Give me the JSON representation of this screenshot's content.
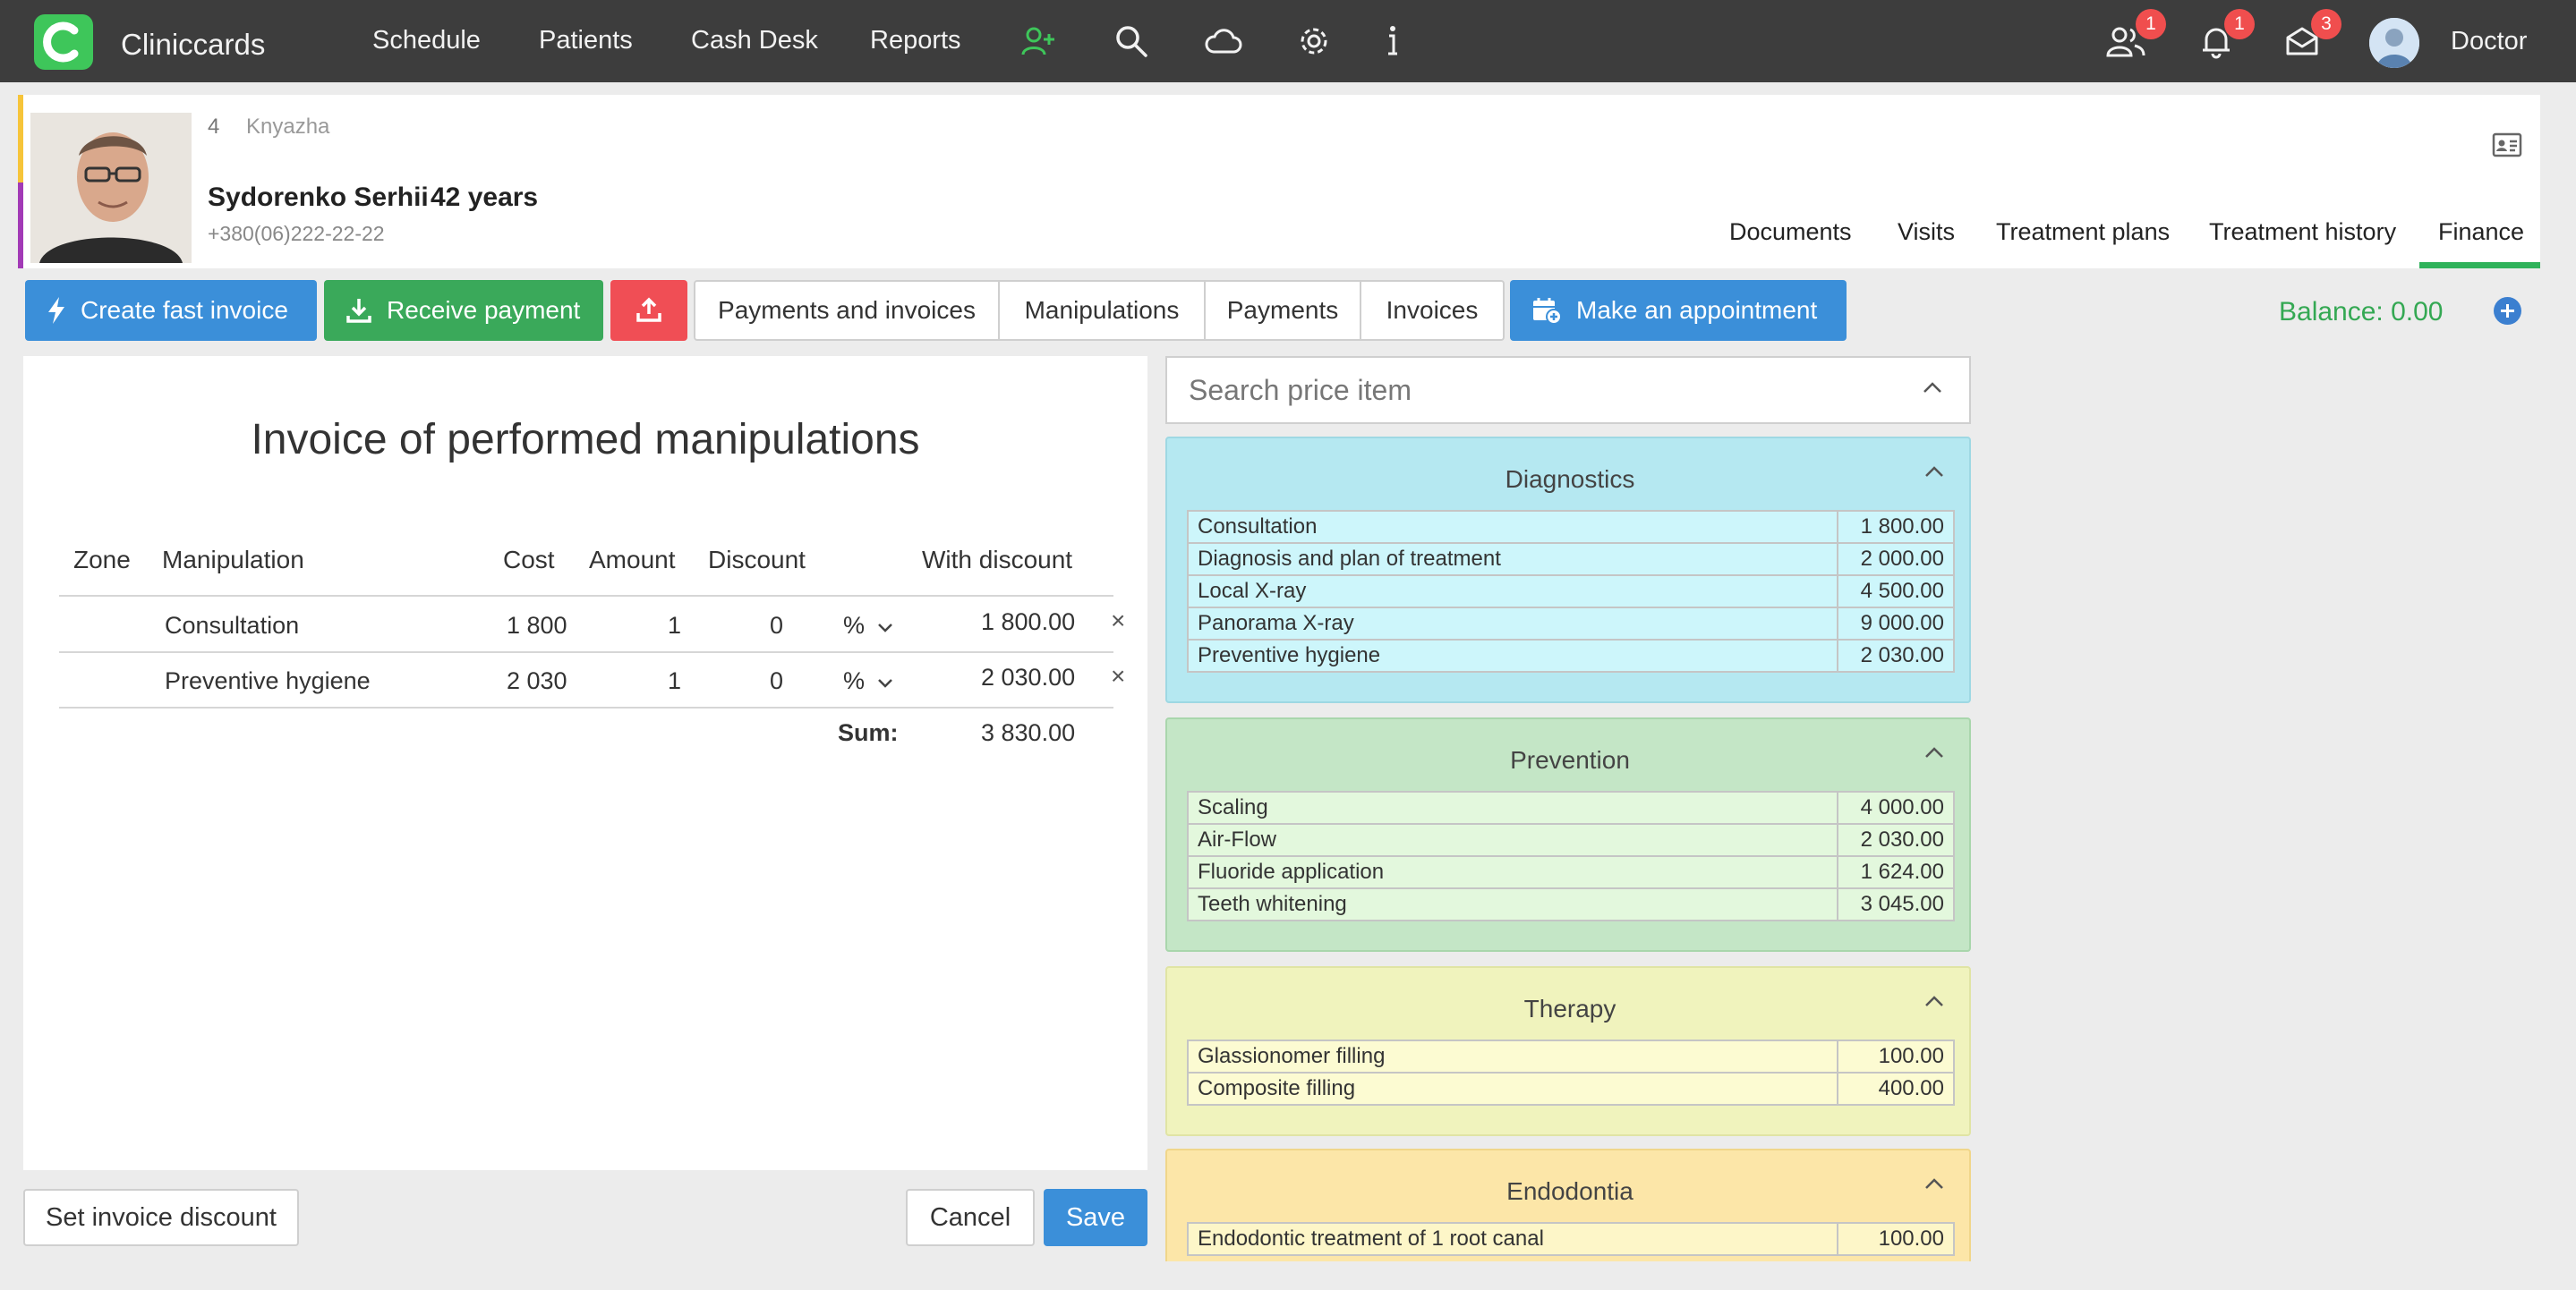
{
  "nav": {
    "brand": "Cliniccards",
    "links": [
      "Schedule",
      "Patients",
      "Cash Desk",
      "Reports"
    ],
    "badges": {
      "users": "1",
      "notifications": "1",
      "messages": "3"
    },
    "user": "Doctor"
  },
  "patient": {
    "number": "4",
    "clinic": "Knyazha",
    "name": "Sydorenko Serhii",
    "age": "42 years",
    "phone": "+380(06)222-22-22",
    "tabs": [
      "Documents",
      "Visits",
      "Treatment plans",
      "Treatment history",
      "Finance"
    ],
    "active_tab": "Finance"
  },
  "actions": {
    "fast_invoice": "Create fast invoice",
    "receive_payment": "Receive payment",
    "segments": [
      "Payments and invoices",
      "Manipulations",
      "Payments",
      "Invoices"
    ],
    "appointment": "Make an appointment",
    "balance": "Balance: 0.00"
  },
  "invoice": {
    "title": "Invoice of performed manipulations",
    "columns": [
      "Zone",
      "Manipulation",
      "Cost",
      "Amount",
      "Discount",
      "With discount"
    ],
    "rows": [
      {
        "zone": "",
        "manipulation": "Consultation",
        "cost": "1 800",
        "amount": "1",
        "discount": "0",
        "type": "%",
        "with_discount": "1 800.00"
      },
      {
        "zone": "",
        "manipulation": "Preventive hygiene",
        "cost": "2 030",
        "amount": "1",
        "discount": "0",
        "type": "%",
        "with_discount": "2 030.00"
      }
    ],
    "sum_label": "Sum:",
    "sum": "3 830.00",
    "set_discount": "Set invoice discount",
    "cancel": "Cancel",
    "save": "Save"
  },
  "price": {
    "search_placeholder": "Search price item",
    "colors": {
      "diagnostics": "#b5e8f1",
      "prevention": "#c4e6c6",
      "therapy": "#f0f3bd",
      "endodontia": "#fce6a8"
    },
    "categories": [
      {
        "name": "Diagnostics",
        "items": [
          {
            "name": "Consultation",
            "price": "1 800.00"
          },
          {
            "name": "Diagnosis and plan of treatment",
            "price": "2 000.00"
          },
          {
            "name": "Local X-ray",
            "price": "4 500.00"
          },
          {
            "name": "Panorama X-ray",
            "price": "9 000.00"
          },
          {
            "name": "Preventive hygiene",
            "price": "2 030.00"
          }
        ]
      },
      {
        "name": "Prevention",
        "items": [
          {
            "name": "Scaling",
            "price": "4 000.00"
          },
          {
            "name": "Air-Flow",
            "price": "2 030.00"
          },
          {
            "name": "Fluoride application",
            "price": "1 624.00"
          },
          {
            "name": "Teeth whitening",
            "price": "3 045.00"
          }
        ]
      },
      {
        "name": "Therapy",
        "items": [
          {
            "name": "Glassionomer filling",
            "price": "100.00"
          },
          {
            "name": "Composite filling",
            "price": "400.00"
          }
        ]
      },
      {
        "name": "Endodontia",
        "items": [
          {
            "name": "Endodontic treatment of 1 root canal",
            "price": "100.00"
          }
        ]
      }
    ]
  }
}
